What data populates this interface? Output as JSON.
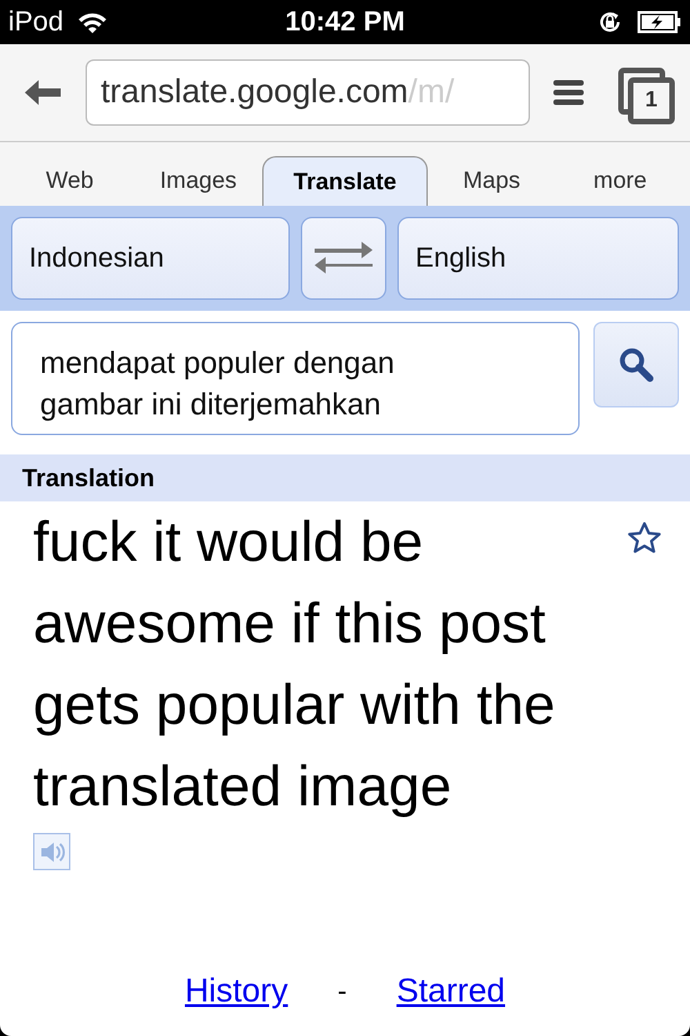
{
  "status_bar": {
    "device": "iPod",
    "time": "10:42 PM"
  },
  "browser": {
    "url": "translate.google.com",
    "url_faded": "/m/",
    "tab_count": "1"
  },
  "tabs": [
    {
      "label": "Web",
      "selected": false
    },
    {
      "label": "Images",
      "selected": false
    },
    {
      "label": "Translate",
      "selected": true
    },
    {
      "label": "Maps",
      "selected": false
    },
    {
      "label": "more",
      "selected": false
    }
  ],
  "languages": {
    "source": "Indonesian",
    "target": "English"
  },
  "input": {
    "value": "mendapat populer dengan\ngambar ini diterjemahkan"
  },
  "translation": {
    "heading": "Translation",
    "text": "fuck it would be awesome if this post gets popular with the translated image",
    "starred": false
  },
  "footer_links": [
    {
      "label": "History"
    },
    {
      "label": "Starred"
    }
  ],
  "separator": "-"
}
